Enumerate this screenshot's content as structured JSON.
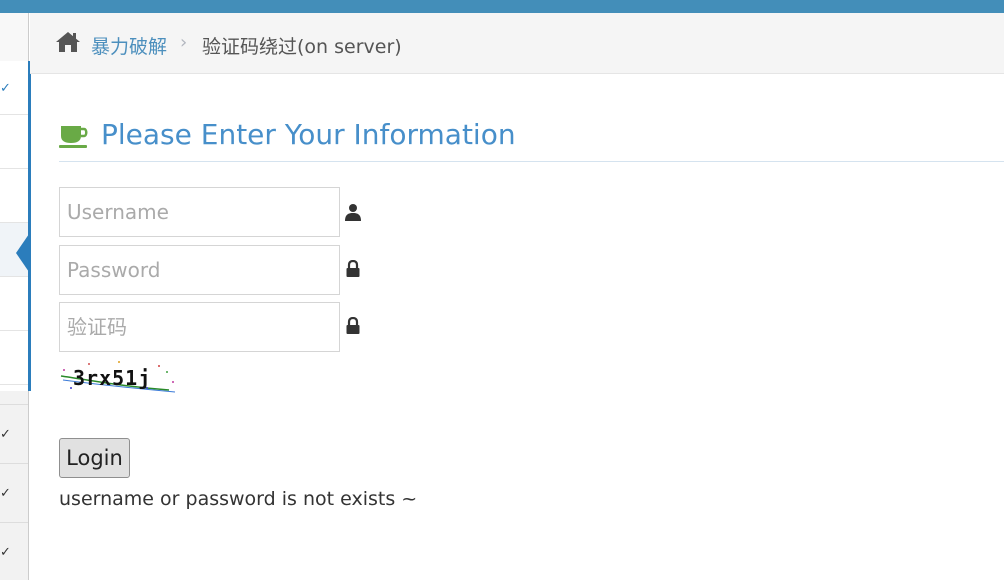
{
  "breadcrumb": {
    "link": "暴力破解",
    "separator": "›",
    "current": "验证码绕过(on server)"
  },
  "header": {
    "title": "Please Enter Your Information"
  },
  "form": {
    "username_placeholder": "Username",
    "password_placeholder": "Password",
    "captcha_placeholder": "验证码",
    "captcha_image_text": "3rx51j",
    "login_label": "Login"
  },
  "message": "username or password is not exists ~",
  "colors": {
    "topbar": "#438eb9",
    "title": "#478fca",
    "link": "#4c8fbd",
    "cup_icon": "#69aa46",
    "active_marker": "#2b7dbc"
  },
  "icons": {
    "home": "home-icon",
    "cup": "coffee-cup-icon",
    "user": "user-icon",
    "lock": "lock-icon",
    "check": "check-icon"
  }
}
